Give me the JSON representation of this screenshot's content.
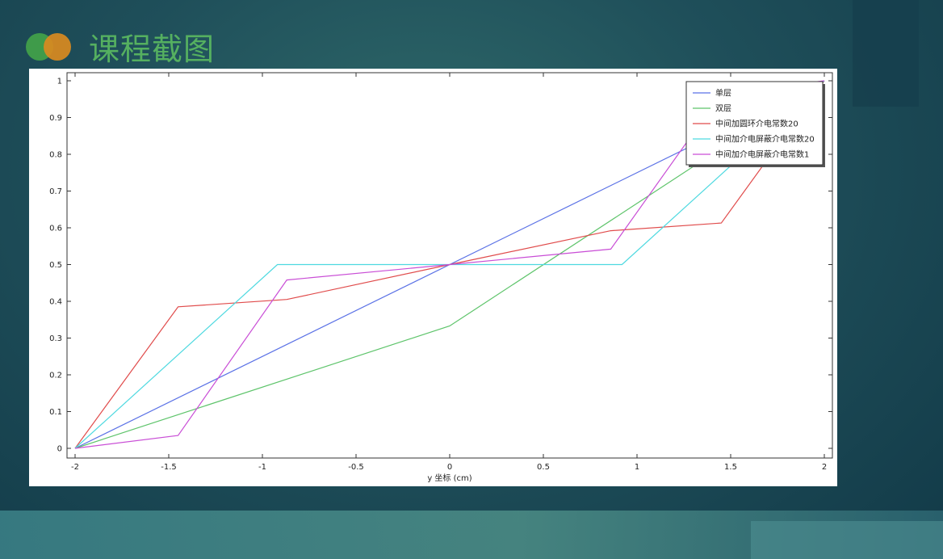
{
  "header": {
    "title": "课程截图"
  },
  "colors": {
    "title": "#55b060",
    "logo_left": "#3f9b4a",
    "logo_right": "#d98a1f"
  },
  "chart_data": {
    "type": "line",
    "xlabel": "y 坐标 (cm)",
    "ylabel": "",
    "xlim": [
      -2,
      2
    ],
    "ylim": [
      0,
      1
    ],
    "xticks": [
      -2,
      -1.5,
      -1,
      -0.5,
      0,
      0.5,
      1,
      1.5,
      2
    ],
    "xtick_labels": [
      "-2",
      "-1.5",
      "-1",
      "-0.5",
      "0",
      "0.5",
      "1",
      "1.5",
      "2"
    ],
    "yticks": [
      0,
      0.1,
      0.2,
      0.3,
      0.4,
      0.5,
      0.6,
      0.7,
      0.8,
      0.9,
      1
    ],
    "ytick_labels": [
      "0",
      "0.1",
      "0.2",
      "0.3",
      "0.4",
      "0.5",
      "0.6",
      "0.7",
      "0.8",
      "0.9",
      "1"
    ],
    "grid": false,
    "legend_position": "top-right",
    "series": [
      {
        "name": "单层",
        "color": "#5b72e6",
        "points": [
          [
            -2,
            0
          ],
          [
            2,
            1
          ]
        ]
      },
      {
        "name": "双层",
        "color": "#5ec46b",
        "points": [
          [
            -2,
            0
          ],
          [
            0,
            0.333
          ],
          [
            2,
            1
          ]
        ]
      },
      {
        "name": "中间加圆环介电常数20",
        "color": "#e04b4b",
        "points": [
          [
            -2,
            0
          ],
          [
            -1.45,
            0.385
          ],
          [
            -0.87,
            0.405
          ],
          [
            0,
            0.5
          ],
          [
            0.86,
            0.592
          ],
          [
            1.45,
            0.613
          ],
          [
            2,
            1
          ]
        ]
      },
      {
        "name": "中间加介电屏蔽介电常数20",
        "color": "#4ed9e0",
        "points": [
          [
            -2,
            0
          ],
          [
            -0.92,
            0.5
          ],
          [
            0.92,
            0.5
          ],
          [
            2,
            1
          ]
        ]
      },
      {
        "name": "中间加介电屏蔽介电常数1",
        "color": "#c94ed6",
        "points": [
          [
            -2,
            0
          ],
          [
            -1.45,
            0.035
          ],
          [
            -0.87,
            0.458
          ],
          [
            0,
            0.5
          ],
          [
            0.86,
            0.542
          ],
          [
            1.45,
            0.965
          ],
          [
            2,
            1
          ]
        ]
      }
    ]
  }
}
